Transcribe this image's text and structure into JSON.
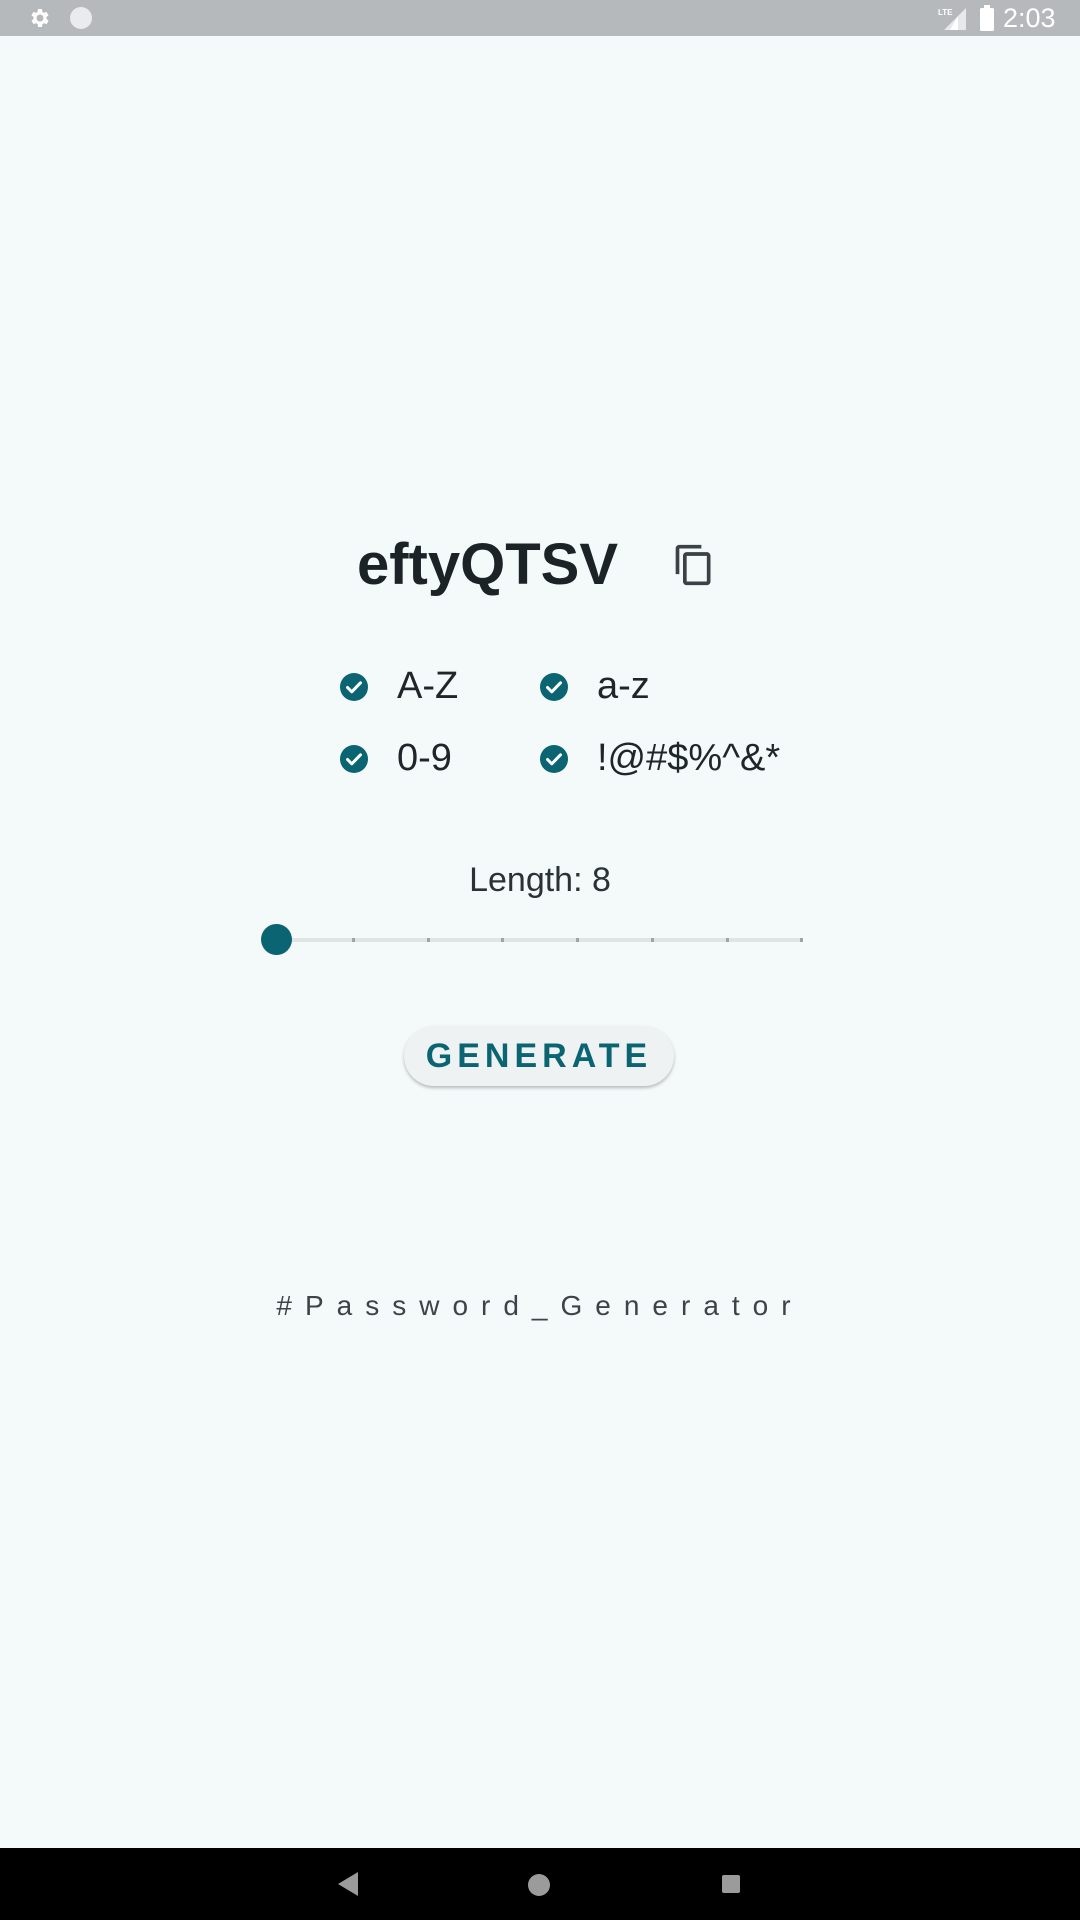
{
  "status_bar": {
    "time": "2:03",
    "network_label": "LTE",
    "icons": [
      "gear-icon",
      "circle-icon",
      "signal-icon",
      "battery-icon"
    ]
  },
  "password": {
    "value": "eftyQTSV",
    "copy_icon": "copy-icon"
  },
  "options": [
    {
      "label": "A-Z",
      "checked": true
    },
    {
      "label": "a-z",
      "checked": true
    },
    {
      "label": "0-9",
      "checked": true
    },
    {
      "label": "!@#$%^&*",
      "checked": true
    }
  ],
  "length": {
    "label": "Length: 8",
    "value": 8,
    "slider_fraction": 0.0
  },
  "generate_label": "GENERATE",
  "hashtag": "#Password_Generator",
  "colors": {
    "accent": "#0a6472",
    "background": "#f4f9fa",
    "status_bar": "#b6b9bb",
    "nav_bar": "#000000"
  },
  "nav": {
    "icons": [
      "back-icon",
      "home-icon",
      "recents-icon"
    ]
  }
}
